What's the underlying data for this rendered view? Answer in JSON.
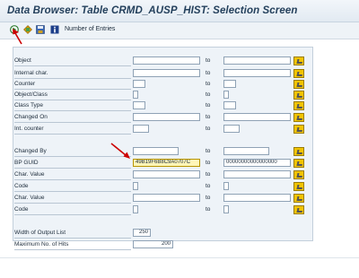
{
  "window": {
    "title": "Data Browser: Table CRMD_AUSP_HIST: Selection Screen"
  },
  "toolbar": {
    "execute_icon": "execute-icon",
    "number_of_entries_label": "Number of Entries"
  },
  "fields": {
    "object": {
      "label": "Object",
      "from": "",
      "to": ""
    },
    "internal_char": {
      "label": "Internal char.",
      "from": "",
      "to": ""
    },
    "counter": {
      "label": "Counter",
      "from": "",
      "to": ""
    },
    "object_class": {
      "label": "Object/Class",
      "from": "",
      "to": ""
    },
    "class_type": {
      "label": "Class Type",
      "from": "",
      "to": ""
    },
    "changed_on": {
      "label": "Changed On",
      "from": "",
      "to": ""
    },
    "int_counter": {
      "label": "Int. counter",
      "from": "",
      "to": ""
    },
    "changed_by": {
      "label": "Changed By",
      "from": "",
      "to": ""
    },
    "bp_guid": {
      "label": "BP GUID",
      "from": "49B19F6B8C9A0707C",
      "to": "00000000000000000"
    },
    "char_value_1": {
      "label": "Char. Value",
      "from": "",
      "to": ""
    },
    "code_1": {
      "label": "Code",
      "from": "",
      "to": ""
    },
    "char_value_2": {
      "label": "Char. Value",
      "from": "",
      "to": ""
    },
    "code_2": {
      "label": "Code",
      "from": "",
      "to": ""
    },
    "width_output": {
      "label": "Width of Output List",
      "value": "250"
    },
    "max_hits": {
      "label": "Maximum No. of Hits",
      "value": "200"
    }
  },
  "to_label": "to",
  "annotation_color": "#cc0000"
}
